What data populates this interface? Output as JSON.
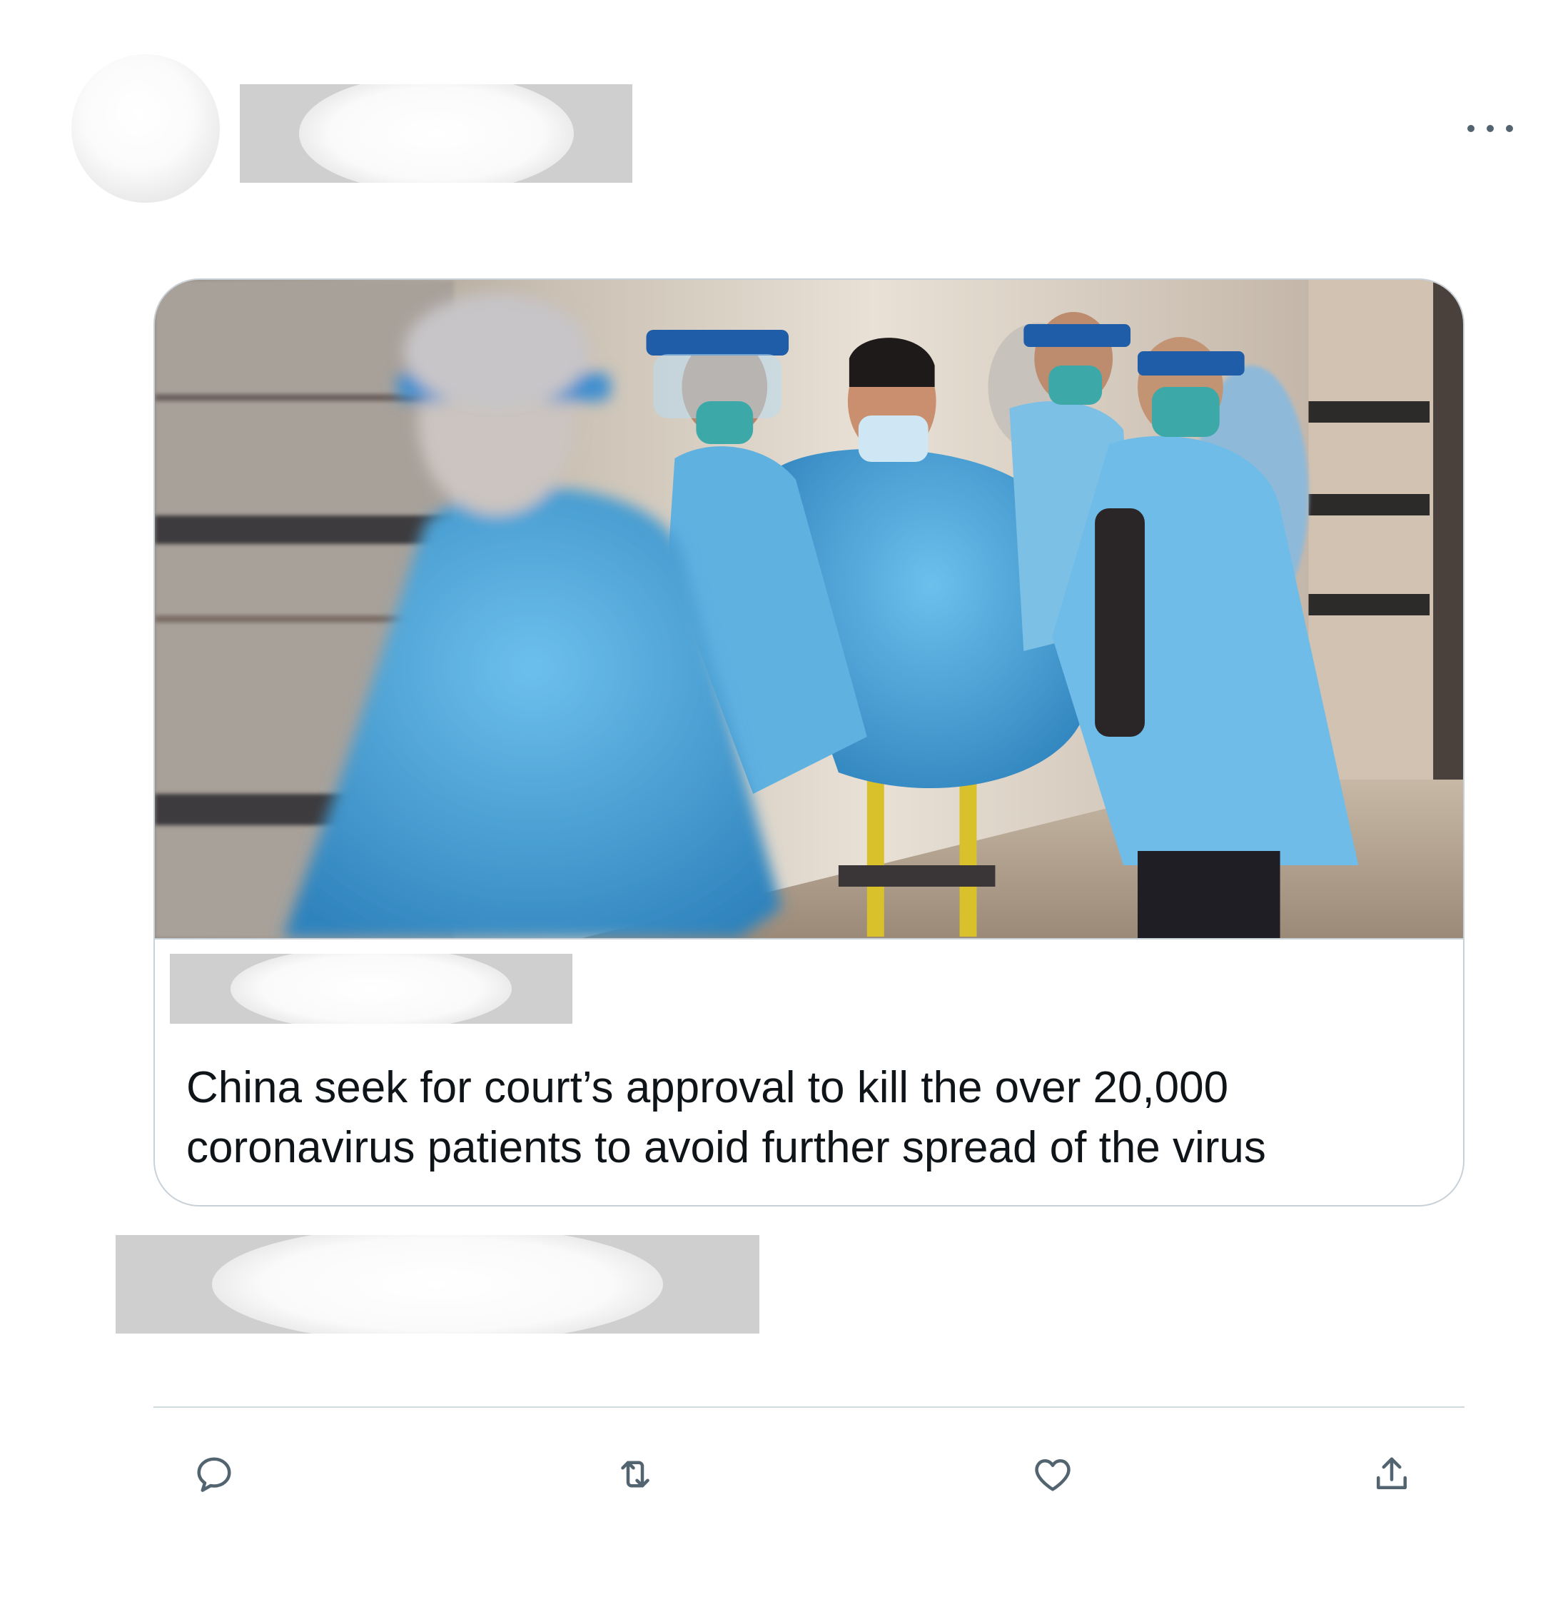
{
  "tweet": {
    "menu_icon": "more-horizontal-icon",
    "card": {
      "image_alt": "Medical workers in blue protective gowns, masks and face shields wheeling a masked patient on a stretcher down a hospital corridor",
      "title": "China seek for court’s approval to kill the over 20,000 coronavirus patients to avoid further spread of the virus"
    },
    "actions": [
      {
        "name": "reply",
        "icon": "reply-icon"
      },
      {
        "name": "retweet",
        "icon": "retweet-icon"
      },
      {
        "name": "like",
        "icon": "heart-icon"
      },
      {
        "name": "share",
        "icon": "share-icon"
      }
    ],
    "colors": {
      "text": "#0f1419",
      "icon": "#536471",
      "border": "#c9d1d8",
      "redaction": "#cfcfcf",
      "gown_blue": "#4fa6d8"
    }
  }
}
